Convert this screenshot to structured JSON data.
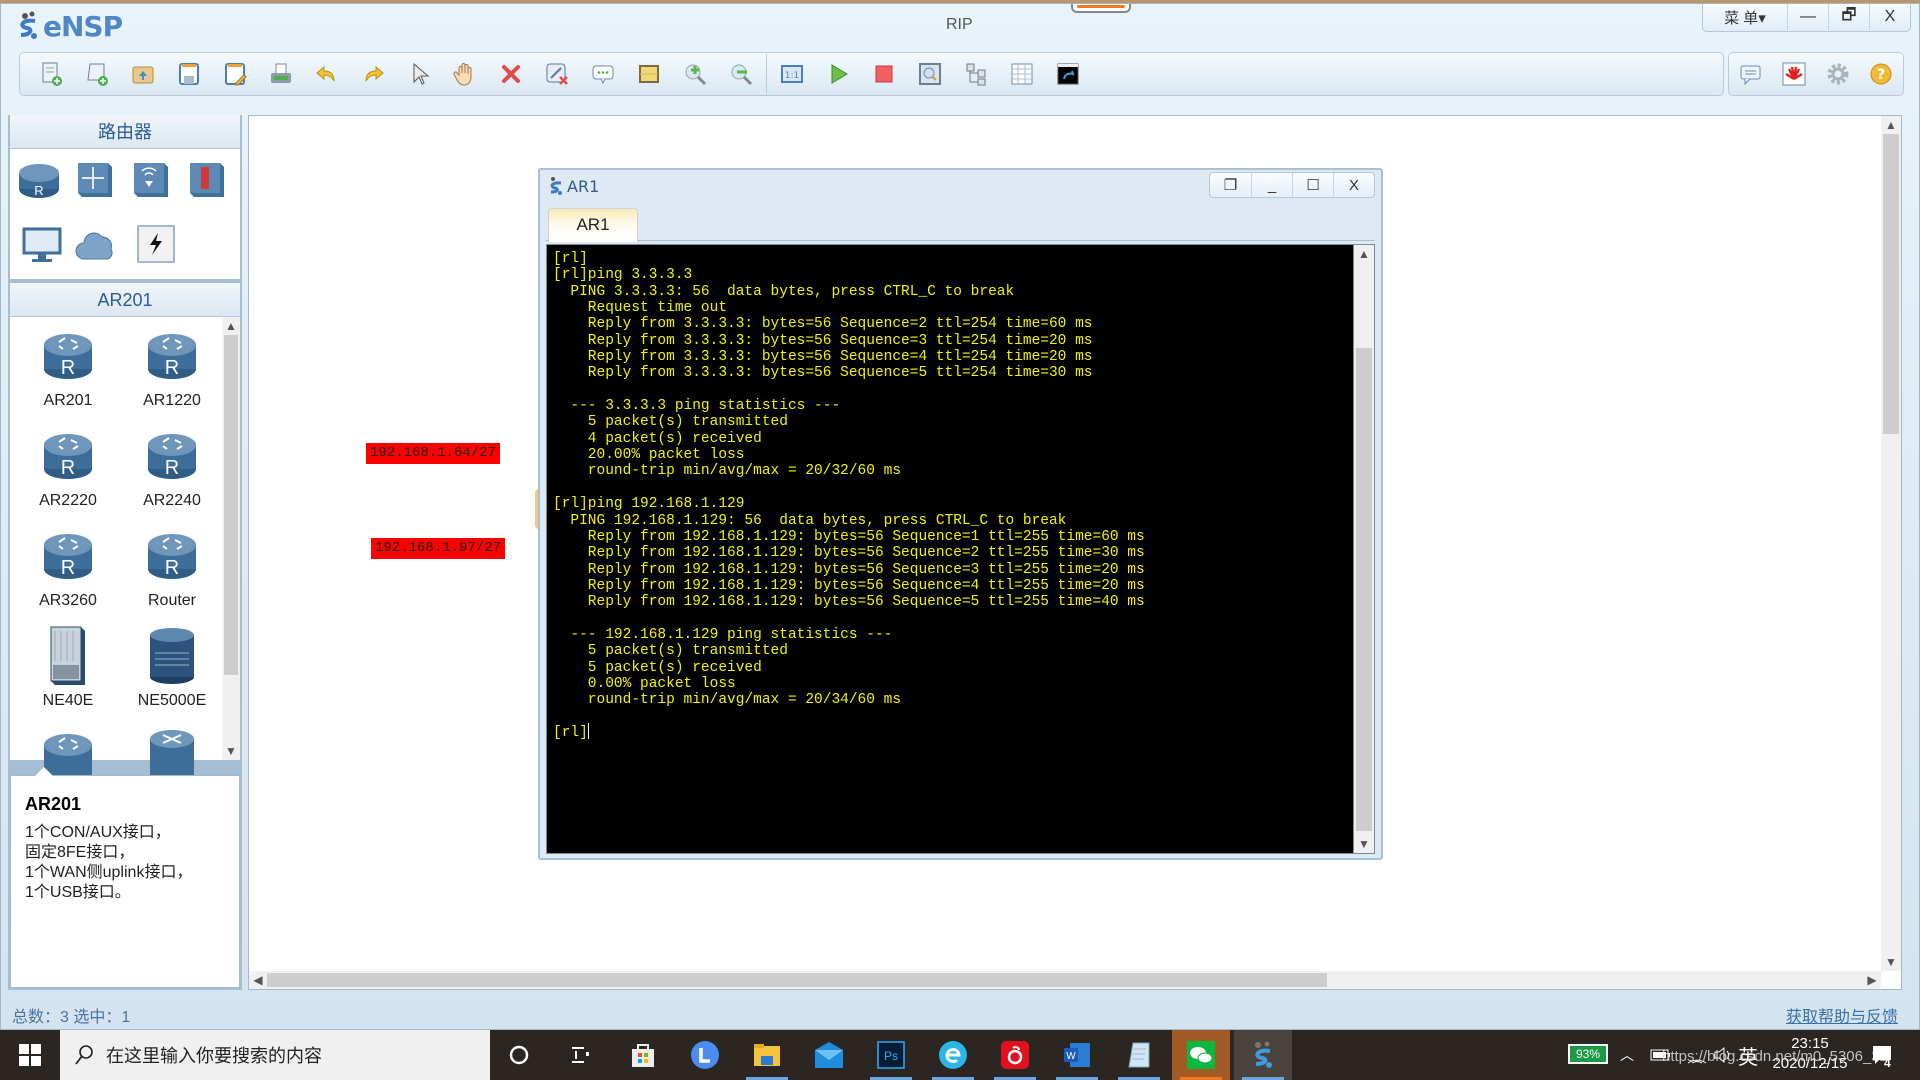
{
  "app": {
    "logo_text": "eNSP",
    "title": "RIP",
    "window_controls": {
      "menu": "菜 单▾",
      "minimize": "—",
      "restore": "🗗",
      "close": "X"
    }
  },
  "toolbar": {
    "left_icons": [
      "new-topology-icon",
      "new-script-icon",
      "open-icon",
      "save-icon",
      "save-as-icon",
      "print-icon",
      "undo-icon",
      "redo-icon",
      "select-pointer-icon",
      "pan-hand-icon",
      "delete-icon",
      "delete-link-icon",
      "text-note-icon",
      "palette-icon",
      "zoom-in-icon",
      "zoom-out-icon",
      "actual-size-icon",
      "start-devices-icon",
      "stop-devices-icon",
      "capture-icon",
      "topology-icon",
      "grid-icon",
      "terminal-icon"
    ],
    "right_icons": [
      "message-icon",
      "huawei-logo-icon",
      "settings-gear-icon",
      "help-icon"
    ]
  },
  "left_panel": {
    "category_header": "路由器",
    "category_icons": [
      "router-category-icon",
      "switch-category-icon",
      "wlan-category-icon",
      "firewall-category-icon",
      "pc-category-icon",
      "cloud-category-icon",
      "link-category-icon"
    ],
    "device_header": "AR201",
    "devices": [
      {
        "label": "AR201",
        "type": "router"
      },
      {
        "label": "AR1220",
        "type": "router"
      },
      {
        "label": "AR2220",
        "type": "router"
      },
      {
        "label": "AR2240",
        "type": "router"
      },
      {
        "label": "AR3260",
        "type": "router"
      },
      {
        "label": "Router",
        "type": "router"
      },
      {
        "label": "NE40E",
        "type": "chassis"
      },
      {
        "label": "NE5000E",
        "type": "cluster"
      },
      {
        "label": "",
        "type": "router-partial"
      },
      {
        "label": "",
        "type": "cx-partial"
      }
    ],
    "info": {
      "title": "AR201",
      "lines": [
        "1个CON/AUX接口，",
        "固定8FE接口，",
        "1个WAN侧uplink接口，",
        "1个USB接口。"
      ]
    }
  },
  "canvas": {
    "labels": [
      "192.168.1.64/27",
      "192.168.1.97/27"
    ],
    "label_color": "#ff0000"
  },
  "terminal_window": {
    "title": "AR1",
    "tab": "AR1",
    "controls": {
      "restore": "❐",
      "minimize": "_",
      "maximize": "☐",
      "close": "X"
    },
    "lines": [
      "[rl]",
      "[rl]ping 3.3.3.3",
      "  PING 3.3.3.3: 56  data bytes, press CTRL_C to break",
      "    Request time out",
      "    Reply from 3.3.3.3: bytes=56 Sequence=2 ttl=254 time=60 ms",
      "    Reply from 3.3.3.3: bytes=56 Sequence=3 ttl=254 time=20 ms",
      "    Reply from 3.3.3.3: bytes=56 Sequence=4 ttl=254 time=20 ms",
      "    Reply from 3.3.3.3: bytes=56 Sequence=5 ttl=254 time=30 ms",
      "",
      "  --- 3.3.3.3 ping statistics ---",
      "    5 packet(s) transmitted",
      "    4 packet(s) received",
      "    20.00% packet loss",
      "    round-trip min/avg/max = 20/32/60 ms",
      "",
      "[rl]ping 192.168.1.129",
      "  PING 192.168.1.129: 56  data bytes, press CTRL_C to break",
      "    Reply from 192.168.1.129: bytes=56 Sequence=1 ttl=255 time=60 ms",
      "    Reply from 192.168.1.129: bytes=56 Sequence=2 ttl=255 time=30 ms",
      "    Reply from 192.168.1.129: bytes=56 Sequence=3 ttl=255 time=20 ms",
      "    Reply from 192.168.1.129: bytes=56 Sequence=4 ttl=255 time=20 ms",
      "    Reply from 192.168.1.129: bytes=56 Sequence=5 ttl=255 time=40 ms",
      "",
      "  --- 192.168.1.129 ping statistics ---",
      "    5 packet(s) transmitted",
      "    5 packet(s) received",
      "    0.00% packet loss",
      "    round-trip min/avg/max = 20/34/60 ms",
      "",
      "[rl]"
    ],
    "text_color": "#f2f200"
  },
  "statusbar": {
    "left": "总数：3  选中：1",
    "right_link": "获取帮助与反馈"
  },
  "taskbar": {
    "search_placeholder": "在这里输入你要搜索的内容",
    "apps": [
      "cortana-icon",
      "task-view-icon",
      "store-icon",
      "lanxin-icon",
      "file-explorer-icon",
      "mail-icon",
      "photoshop-icon",
      "browser-icon",
      "netease-music-icon",
      "word-icon",
      "notepad-icon",
      "wechat-icon",
      "ensp-icon"
    ],
    "battery": "93%",
    "ime": "英",
    "time": "23:15",
    "date": "2020/12/15",
    "notifications": "4",
    "watermark": "https://blog.csdn.net/m0_5306_32"
  }
}
